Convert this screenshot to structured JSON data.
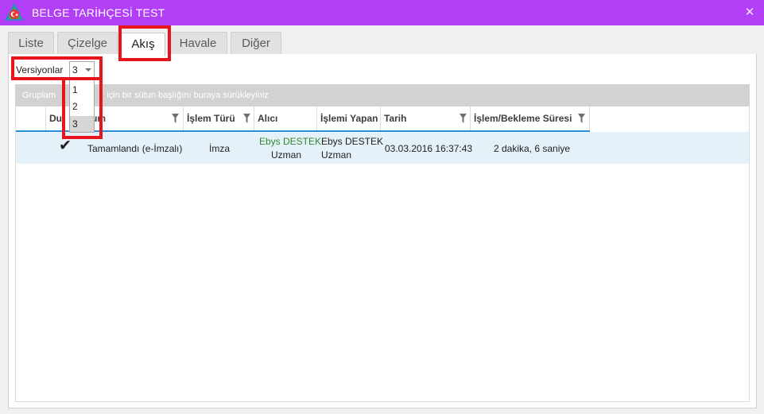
{
  "window": {
    "title": "BELGE TARİHÇESİ TEST",
    "close_glyph": "✕",
    "logo_icon": "app-logo-icon",
    "accent_color": "#b23ff5"
  },
  "tabs": [
    {
      "label": "Liste"
    },
    {
      "label": "Çizelge"
    },
    {
      "label": "Akış"
    },
    {
      "label": "Havale"
    },
    {
      "label": "Diğer"
    }
  ],
  "active_tab": "Akış",
  "versions": {
    "label": "Versiyonlar",
    "selected": "3",
    "options": [
      "1",
      "2",
      "3"
    ]
  },
  "grid": {
    "group_hint_visible": "Gruplam",
    "group_hint_rest": "için bir sütun başlığını buraya sürükleyiniz",
    "columns": {
      "durum": "Du",
      "durum_rest": "um",
      "islem_turu": "İşlem Türü",
      "alici": "Alıcı",
      "islemi_yapan": "İşlemi Yapan",
      "tarih": "Tarih",
      "sure": "İşlem/Bekleme Süresi"
    },
    "rows": [
      {
        "status_icon": "checkmark-icon",
        "check_glyph": "✔",
        "durum": "Tamamlandı (e-İmzalı)",
        "islem_turu": "İmza",
        "alici_name": "Ebys DESTEK",
        "alici_title": "Uzman",
        "islemi_yapan_name": "Ebys DESTEK",
        "islemi_yapan_title": "Uzman",
        "tarih": "03.03.2016 16:37:43",
        "sure": "2 dakika, 6 saniye"
      }
    ]
  }
}
